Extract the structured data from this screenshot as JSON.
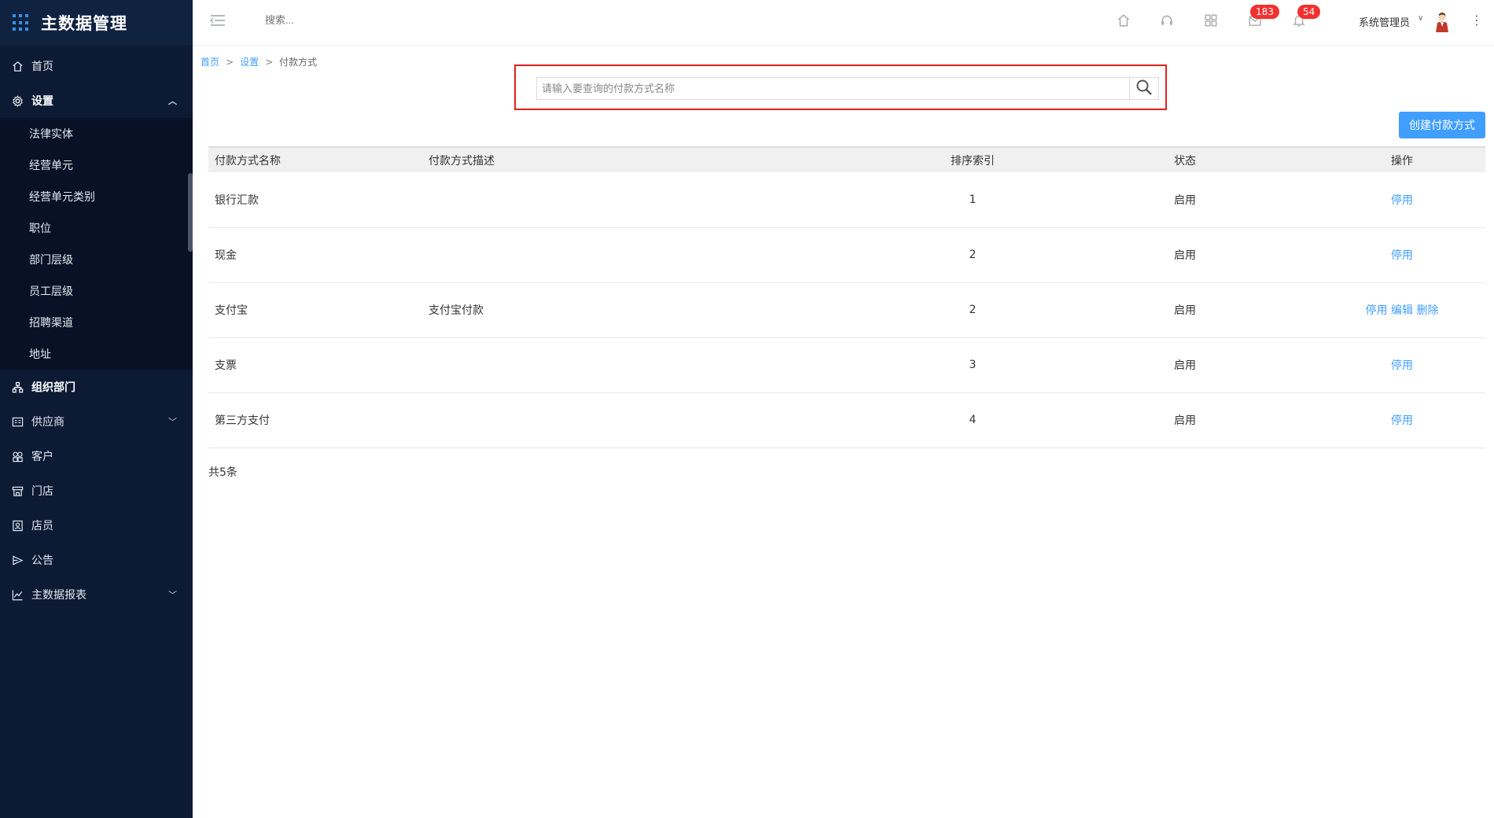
{
  "app": {
    "title": "主数据管理"
  },
  "sidebar": {
    "items": [
      {
        "label": "首页",
        "icon": "home-icon"
      },
      {
        "label": "设置",
        "icon": "gear-icon",
        "expanded": true
      },
      {
        "label": "组织部门",
        "icon": "org-icon"
      },
      {
        "label": "供应商",
        "icon": "supplier-icon"
      },
      {
        "label": "客户",
        "icon": "customer-icon"
      },
      {
        "label": "门店",
        "icon": "store-icon"
      },
      {
        "label": "店员",
        "icon": "clerk-icon"
      },
      {
        "label": "公告",
        "icon": "announcement-icon"
      },
      {
        "label": "主数据报表",
        "icon": "chart-icon"
      }
    ],
    "settings_sub": [
      "法律实体",
      "经营单元",
      "经营单元类别",
      "职位",
      "部门层级",
      "员工层级",
      "招聘渠道",
      "地址"
    ]
  },
  "header": {
    "search_placeholder": "搜索...",
    "badges": {
      "mail": "183",
      "bell": "54"
    },
    "user": "系统管理员"
  },
  "breadcrumb": {
    "home": "首页",
    "settings": "设置",
    "current": "付款方式",
    "sep": ">"
  },
  "search": {
    "placeholder": "请输入要查询的付款方式名称",
    "value": ""
  },
  "actions": {
    "create_label": "创建付款方式"
  },
  "table": {
    "columns": [
      "付款方式名称",
      "付款方式描述",
      "排序索引",
      "状态",
      "操作"
    ],
    "rows": [
      {
        "name": "银行汇款",
        "desc": "",
        "index": "1",
        "status": "启用",
        "ops": [
          "停用"
        ]
      },
      {
        "name": "现金",
        "desc": "",
        "index": "2",
        "status": "启用",
        "ops": [
          "停用"
        ]
      },
      {
        "name": "支付宝",
        "desc": "支付宝付款",
        "index": "2",
        "status": "启用",
        "ops": [
          "停用",
          "编辑",
          "删除"
        ]
      },
      {
        "name": "支票",
        "desc": "",
        "index": "3",
        "status": "启用",
        "ops": [
          "停用"
        ]
      },
      {
        "name": "第三方支付",
        "desc": "",
        "index": "4",
        "status": "启用",
        "ops": [
          "停用"
        ]
      }
    ]
  },
  "footer": {
    "total": "共5条"
  },
  "colors": {
    "sidebar_bg": "#0c1a33",
    "accent": "#409eff",
    "highlight": "#e02020",
    "badge": "#f23030"
  }
}
